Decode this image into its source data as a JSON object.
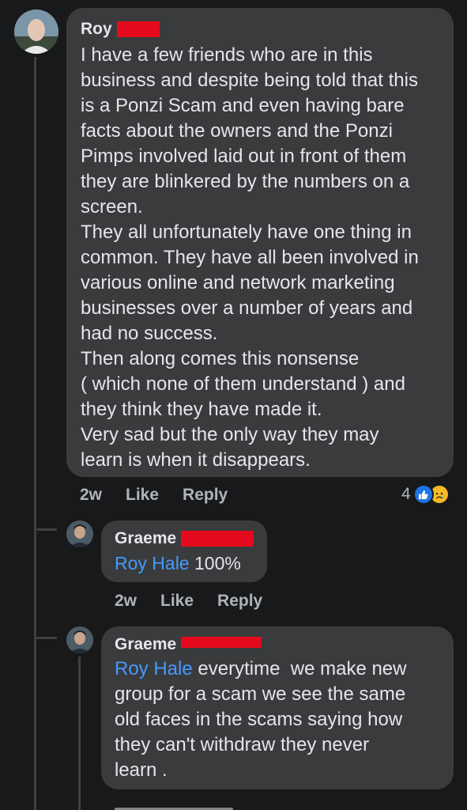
{
  "comment": {
    "author": "Roy",
    "lines": [
      "I have a few friends who are in this",
      "business and despite being told that this",
      "is a Ponzi Scam and even having bare",
      "facts about the owners and the Ponzi",
      "Pimps involved laid out in front of them",
      "they are blinkered by the numbers on a",
      "screen.",
      "They all unfortunately have one thing in",
      "common. They have all been involved in",
      "various online and network marketing",
      "businesses over a number of years and",
      "had no success.",
      "Then along comes this nonsense",
      "( which none of them understand ) and",
      "they think they have made it.",
      "Very sad but the only way they may",
      "learn is when it disappears."
    ],
    "time": "2w",
    "like_label": "Like",
    "reply_label": "Reply",
    "reaction_count": "4",
    "reaction_icons": [
      "like-icon",
      "sad-face-icon"
    ],
    "colors": {
      "like": "#1b74e4",
      "sad": "#f7b928",
      "redaction": "#e5091e"
    }
  },
  "reply1": {
    "author": "Graeme",
    "mention": "Roy Hale",
    "text": " 100%",
    "time": "2w",
    "like_label": "Like",
    "reply_label": "Reply"
  },
  "reply2": {
    "author": "Graeme",
    "mention": "Roy Hale",
    "first_line_rest": " everytime  we make new",
    "lines": [
      "group for a scam we see the same",
      "old faces in the scams saying how",
      "they can't withdraw they never",
      "learn ."
    ]
  }
}
